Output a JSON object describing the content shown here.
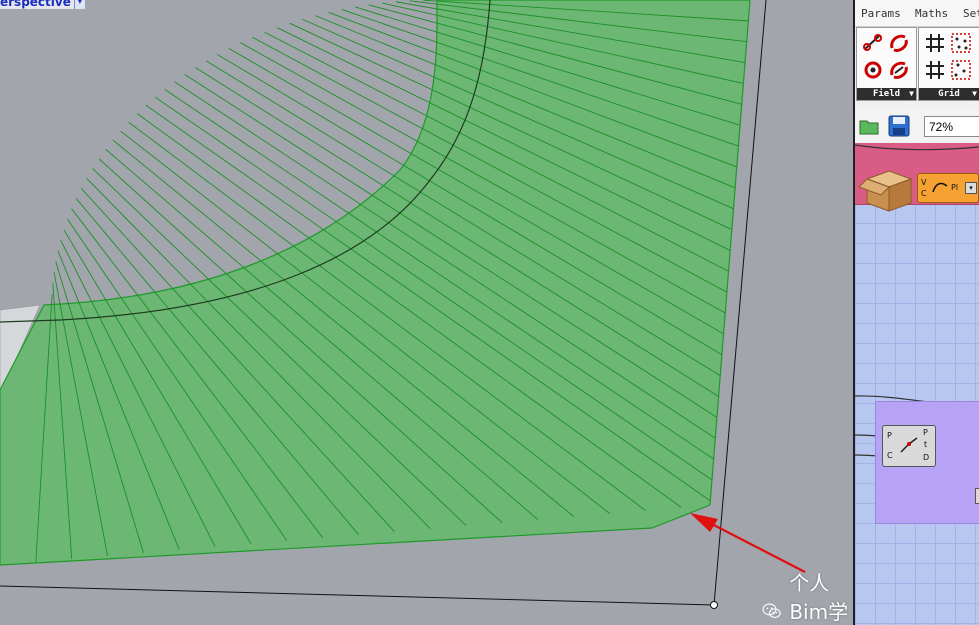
{
  "viewport": {
    "label": "erspective",
    "caret": "▾"
  },
  "panel": {
    "menu": [
      "Params",
      "Maths",
      "Set"
    ],
    "groups": [
      {
        "label": "Field",
        "arrow": "▼"
      },
      {
        "label": "Grid",
        "arrow": "▼"
      }
    ],
    "zoom": "72%",
    "nodes": {
      "orange_label": "Pl",
      "orange_inputs": [
        "V",
        "C"
      ],
      "purple_inputs": [
        "P",
        "C"
      ],
      "purple_outputs": [
        "P",
        "t",
        "D"
      ]
    }
  },
  "watermark": {
    "text": "个人Bim学习"
  },
  "colors": {
    "surface": "#6db775",
    "surface_edge": "#1e9a2a",
    "viewport_bg": "#a2a5ac",
    "arrow": "#e01010",
    "canvas_bg": "#b8c7f0",
    "group_pink": "#d95c87",
    "group_purple": "#b7a3f5"
  }
}
